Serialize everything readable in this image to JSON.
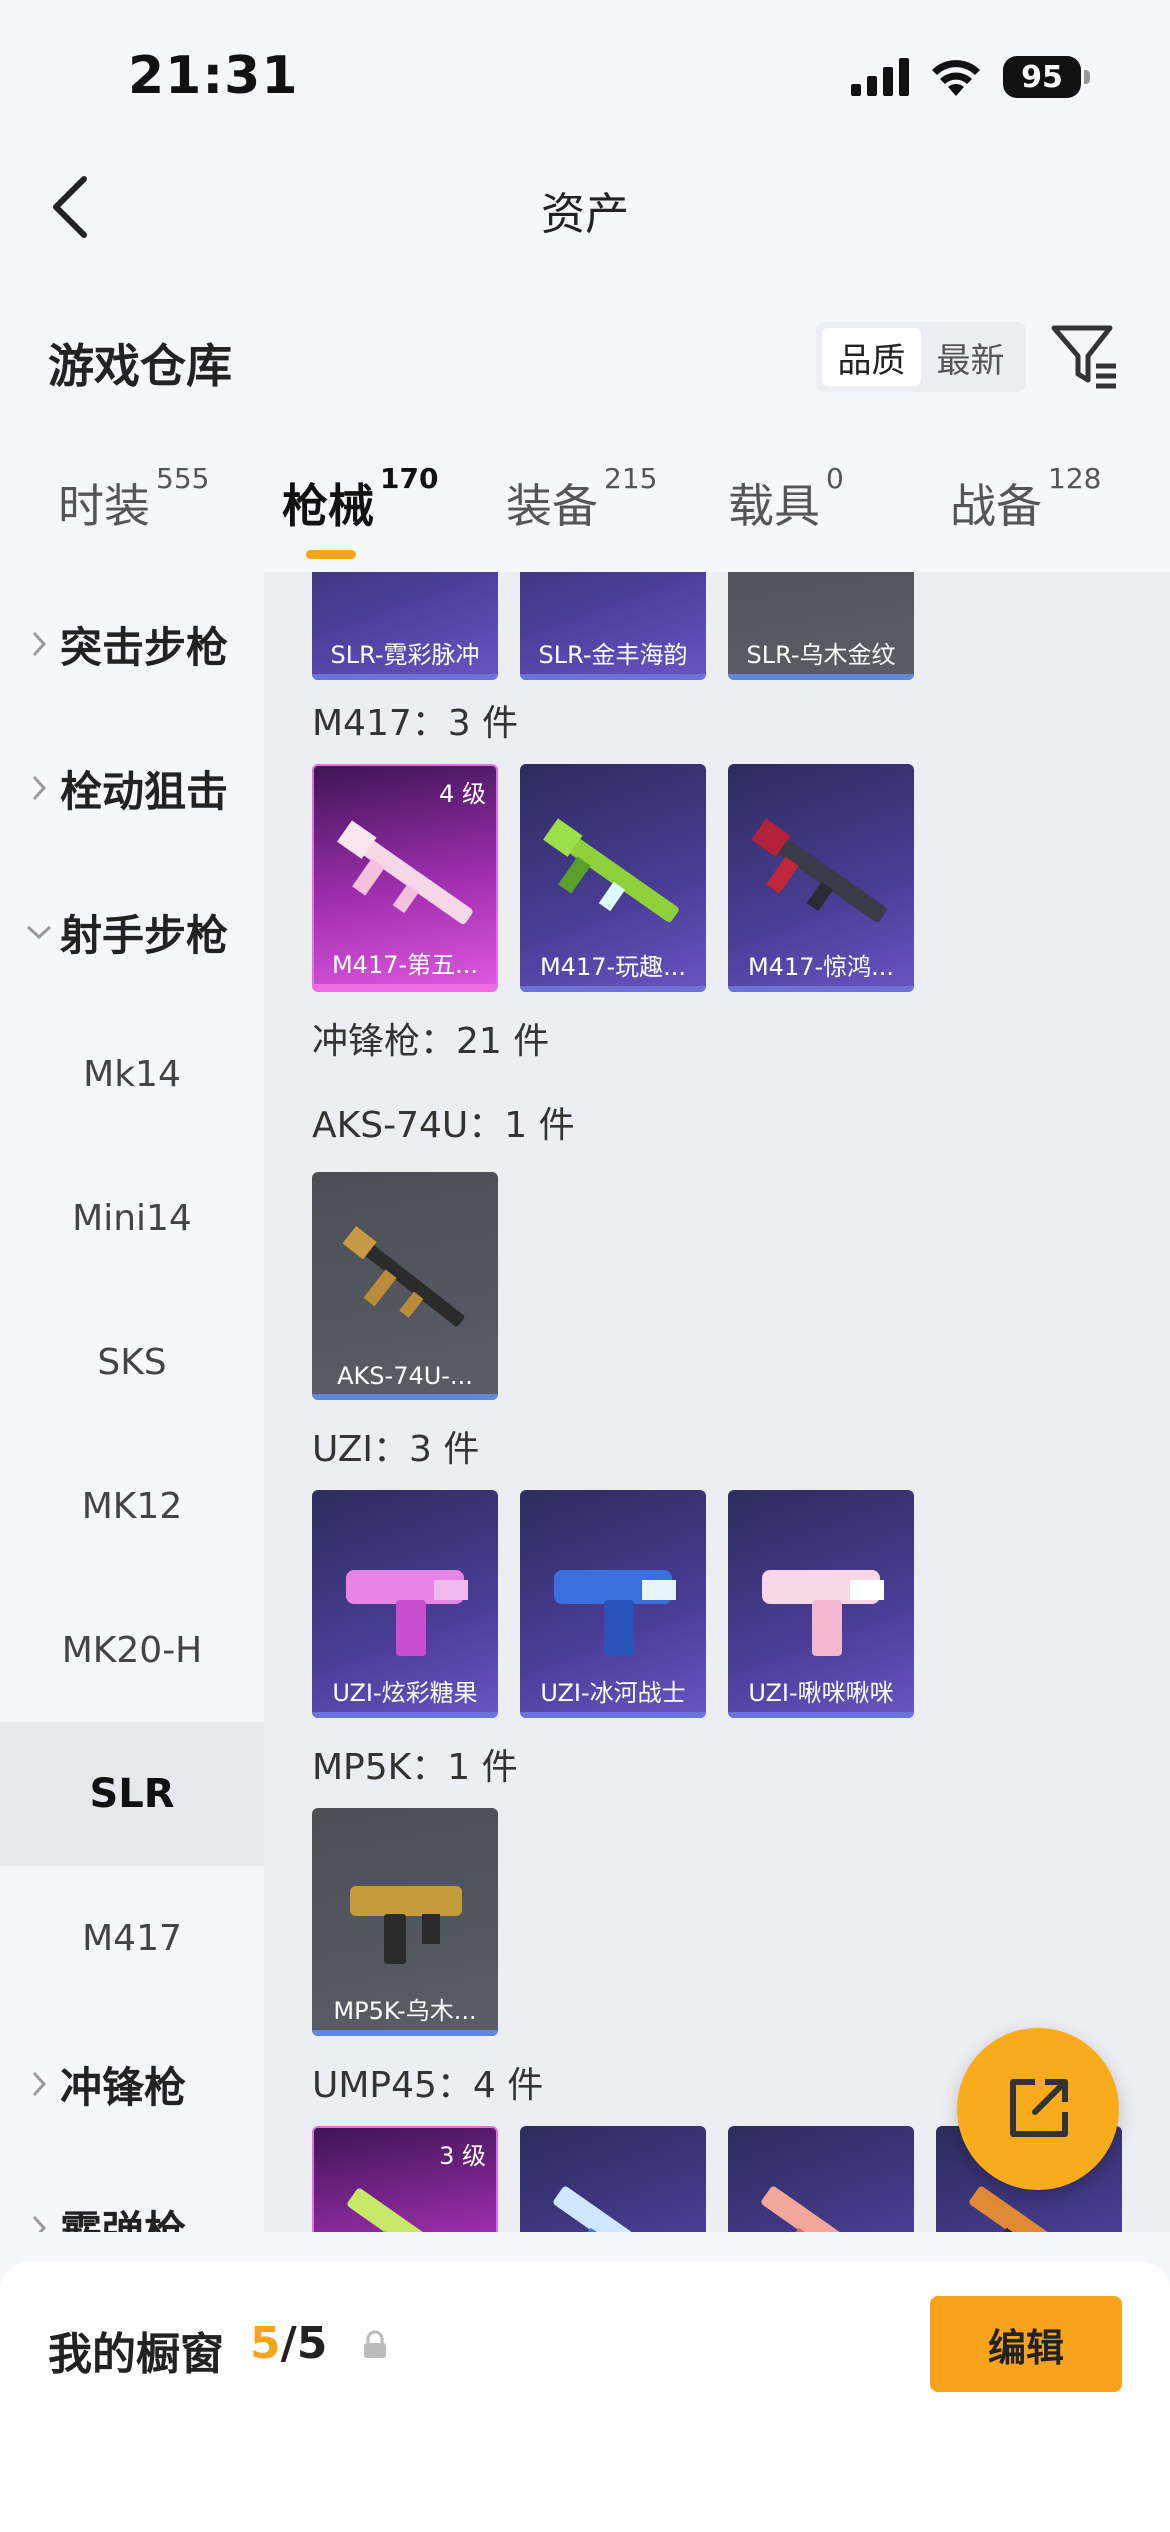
{
  "status_bar": {
    "time": "21:31",
    "battery": "95"
  },
  "nav": {
    "title": "资产"
  },
  "warehouse": {
    "title": "游戏仓库",
    "sort_options": [
      "品质",
      "最新"
    ],
    "active_sort": "品质"
  },
  "tabs": [
    {
      "label": "时装",
      "count": "555"
    },
    {
      "label": "枪械",
      "count": "170",
      "active": true
    },
    {
      "label": "装备",
      "count": "215"
    },
    {
      "label": "载具",
      "count": "0"
    },
    {
      "label": "战备",
      "count": "128"
    }
  ],
  "sidebar": {
    "groups": [
      {
        "label": "突击步枪"
      },
      {
        "label": "栓动狙击"
      },
      {
        "label": "射手步枪"
      },
      {
        "label": "冲锋枪"
      },
      {
        "label": "霰弹枪"
      }
    ],
    "items": [
      {
        "label": "Mk14"
      },
      {
        "label": "Mini14"
      },
      {
        "label": "SKS"
      },
      {
        "label": "MK12"
      },
      {
        "label": "MK20-H"
      },
      {
        "label": "SLR"
      },
      {
        "label": "M417"
      }
    ]
  },
  "content": {
    "slr_cards": [
      {
        "label": "SLR-霓彩脉冲"
      },
      {
        "label": "SLR-金丰海韵"
      },
      {
        "label": "SLR-乌木金纹"
      }
    ],
    "m417_title": "M417：3 件",
    "m417_cards": [
      {
        "label": "M417-第五...",
        "level": "4 级"
      },
      {
        "label": "M417-玩趣..."
      },
      {
        "label": "M417-惊鸿..."
      }
    ],
    "smg_title": "冲锋枪：21 件",
    "aks_title": "AKS-74U：1 件",
    "aks_cards": [
      {
        "label": "AKS-74U-..."
      }
    ],
    "uzi_title": "UZI：3 件",
    "uzi_cards": [
      {
        "label": "UZI-炫彩糖果"
      },
      {
        "label": "UZI-冰河战士"
      },
      {
        "label": "UZI-啾咪啾咪"
      }
    ],
    "mp5k_title": "MP5K：1 件",
    "mp5k_cards": [
      {
        "label": "MP5K-乌木..."
      }
    ],
    "ump_title": "UMP45：4 件",
    "ump_cards": [
      {
        "level": "3 级"
      }
    ]
  },
  "bottom": {
    "title": "我的橱窗",
    "count_current": "5",
    "count_total": "/5",
    "edit_label": "编辑"
  },
  "colors": {
    "accent": "#f9a21b",
    "background": "#f6f7fb",
    "content_bg": "#eceef3"
  }
}
